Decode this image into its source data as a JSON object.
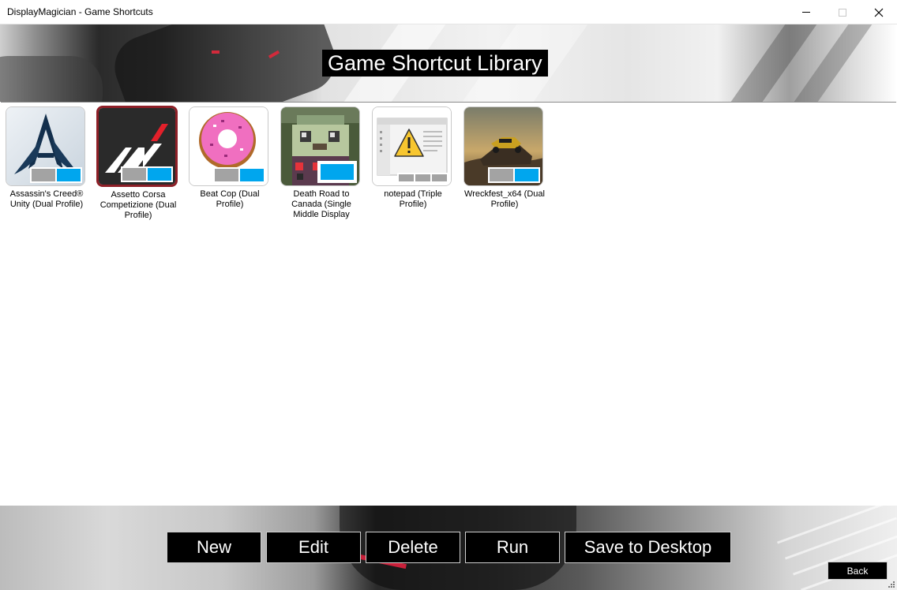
{
  "window": {
    "title": "DisplayMagician - Game Shortcuts"
  },
  "header": {
    "title": "Game Shortcut Library"
  },
  "shortcuts": [
    {
      "label": "Assassin's Creed® Unity (Dual Profile)",
      "icon": "assassins-creed-icon",
      "profile_badge": "dual"
    },
    {
      "label": "Assetto Corsa Competizione (Dual Profile)",
      "icon": "assetto-corsa-icon",
      "profile_badge": "dual",
      "selected": true
    },
    {
      "label": "Beat Cop (Dual Profile)",
      "icon": "donut-icon",
      "profile_badge": "dual"
    },
    {
      "label": "Death Road to Canada (Single Middle Display",
      "icon": "pixel-zombie-icon",
      "profile_badge": "single"
    },
    {
      "label": "notepad (Triple Profile)",
      "icon": "warning-window-icon",
      "profile_badge": "triple"
    },
    {
      "label": "Wreckfest_x64 (Dual Profile)",
      "icon": "wreckfest-car-icon",
      "profile_badge": "dual"
    }
  ],
  "actions": {
    "new": "New",
    "edit": "Edit",
    "delete": "Delete",
    "run": "Run",
    "save_to_desktop": "Save to Desktop"
  },
  "back_label": "Back",
  "colors": {
    "accent_blue": "#00a6ee",
    "badge_gray": "#a3a3a3",
    "selected_border": "#8e1f27",
    "button_bg": "#000000"
  }
}
